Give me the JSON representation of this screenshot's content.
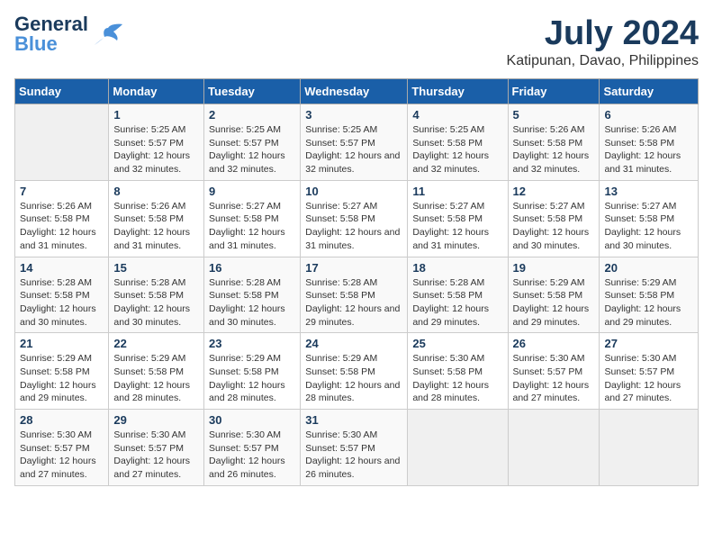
{
  "header": {
    "logo_line1": "General",
    "logo_line2": "Blue",
    "month_year": "July 2024",
    "location": "Katipunan, Davao, Philippines"
  },
  "days_of_week": [
    "Sunday",
    "Monday",
    "Tuesday",
    "Wednesday",
    "Thursday",
    "Friday",
    "Saturday"
  ],
  "weeks": [
    [
      {
        "day": "",
        "empty": true
      },
      {
        "day": "1",
        "sunrise": "Sunrise: 5:25 AM",
        "sunset": "Sunset: 5:57 PM",
        "daylight": "Daylight: 12 hours and 32 minutes."
      },
      {
        "day": "2",
        "sunrise": "Sunrise: 5:25 AM",
        "sunset": "Sunset: 5:57 PM",
        "daylight": "Daylight: 12 hours and 32 minutes."
      },
      {
        "day": "3",
        "sunrise": "Sunrise: 5:25 AM",
        "sunset": "Sunset: 5:57 PM",
        "daylight": "Daylight: 12 hours and 32 minutes."
      },
      {
        "day": "4",
        "sunrise": "Sunrise: 5:25 AM",
        "sunset": "Sunset: 5:58 PM",
        "daylight": "Daylight: 12 hours and 32 minutes."
      },
      {
        "day": "5",
        "sunrise": "Sunrise: 5:26 AM",
        "sunset": "Sunset: 5:58 PM",
        "daylight": "Daylight: 12 hours and 32 minutes."
      },
      {
        "day": "6",
        "sunrise": "Sunrise: 5:26 AM",
        "sunset": "Sunset: 5:58 PM",
        "daylight": "Daylight: 12 hours and 31 minutes."
      }
    ],
    [
      {
        "day": "7",
        "sunrise": "Sunrise: 5:26 AM",
        "sunset": "Sunset: 5:58 PM",
        "daylight": "Daylight: 12 hours and 31 minutes."
      },
      {
        "day": "8",
        "sunrise": "Sunrise: 5:26 AM",
        "sunset": "Sunset: 5:58 PM",
        "daylight": "Daylight: 12 hours and 31 minutes."
      },
      {
        "day": "9",
        "sunrise": "Sunrise: 5:27 AM",
        "sunset": "Sunset: 5:58 PM",
        "daylight": "Daylight: 12 hours and 31 minutes."
      },
      {
        "day": "10",
        "sunrise": "Sunrise: 5:27 AM",
        "sunset": "Sunset: 5:58 PM",
        "daylight": "Daylight: 12 hours and 31 minutes."
      },
      {
        "day": "11",
        "sunrise": "Sunrise: 5:27 AM",
        "sunset": "Sunset: 5:58 PM",
        "daylight": "Daylight: 12 hours and 31 minutes."
      },
      {
        "day": "12",
        "sunrise": "Sunrise: 5:27 AM",
        "sunset": "Sunset: 5:58 PM",
        "daylight": "Daylight: 12 hours and 30 minutes."
      },
      {
        "day": "13",
        "sunrise": "Sunrise: 5:27 AM",
        "sunset": "Sunset: 5:58 PM",
        "daylight": "Daylight: 12 hours and 30 minutes."
      }
    ],
    [
      {
        "day": "14",
        "sunrise": "Sunrise: 5:28 AM",
        "sunset": "Sunset: 5:58 PM",
        "daylight": "Daylight: 12 hours and 30 minutes."
      },
      {
        "day": "15",
        "sunrise": "Sunrise: 5:28 AM",
        "sunset": "Sunset: 5:58 PM",
        "daylight": "Daylight: 12 hours and 30 minutes."
      },
      {
        "day": "16",
        "sunrise": "Sunrise: 5:28 AM",
        "sunset": "Sunset: 5:58 PM",
        "daylight": "Daylight: 12 hours and 30 minutes."
      },
      {
        "day": "17",
        "sunrise": "Sunrise: 5:28 AM",
        "sunset": "Sunset: 5:58 PM",
        "daylight": "Daylight: 12 hours and 29 minutes."
      },
      {
        "day": "18",
        "sunrise": "Sunrise: 5:28 AM",
        "sunset": "Sunset: 5:58 PM",
        "daylight": "Daylight: 12 hours and 29 minutes."
      },
      {
        "day": "19",
        "sunrise": "Sunrise: 5:29 AM",
        "sunset": "Sunset: 5:58 PM",
        "daylight": "Daylight: 12 hours and 29 minutes."
      },
      {
        "day": "20",
        "sunrise": "Sunrise: 5:29 AM",
        "sunset": "Sunset: 5:58 PM",
        "daylight": "Daylight: 12 hours and 29 minutes."
      }
    ],
    [
      {
        "day": "21",
        "sunrise": "Sunrise: 5:29 AM",
        "sunset": "Sunset: 5:58 PM",
        "daylight": "Daylight: 12 hours and 29 minutes."
      },
      {
        "day": "22",
        "sunrise": "Sunrise: 5:29 AM",
        "sunset": "Sunset: 5:58 PM",
        "daylight": "Daylight: 12 hours and 28 minutes."
      },
      {
        "day": "23",
        "sunrise": "Sunrise: 5:29 AM",
        "sunset": "Sunset: 5:58 PM",
        "daylight": "Daylight: 12 hours and 28 minutes."
      },
      {
        "day": "24",
        "sunrise": "Sunrise: 5:29 AM",
        "sunset": "Sunset: 5:58 PM",
        "daylight": "Daylight: 12 hours and 28 minutes."
      },
      {
        "day": "25",
        "sunrise": "Sunrise: 5:30 AM",
        "sunset": "Sunset: 5:58 PM",
        "daylight": "Daylight: 12 hours and 28 minutes."
      },
      {
        "day": "26",
        "sunrise": "Sunrise: 5:30 AM",
        "sunset": "Sunset: 5:57 PM",
        "daylight": "Daylight: 12 hours and 27 minutes."
      },
      {
        "day": "27",
        "sunrise": "Sunrise: 5:30 AM",
        "sunset": "Sunset: 5:57 PM",
        "daylight": "Daylight: 12 hours and 27 minutes."
      }
    ],
    [
      {
        "day": "28",
        "sunrise": "Sunrise: 5:30 AM",
        "sunset": "Sunset: 5:57 PM",
        "daylight": "Daylight: 12 hours and 27 minutes."
      },
      {
        "day": "29",
        "sunrise": "Sunrise: 5:30 AM",
        "sunset": "Sunset: 5:57 PM",
        "daylight": "Daylight: 12 hours and 27 minutes."
      },
      {
        "day": "30",
        "sunrise": "Sunrise: 5:30 AM",
        "sunset": "Sunset: 5:57 PM",
        "daylight": "Daylight: 12 hours and 26 minutes."
      },
      {
        "day": "31",
        "sunrise": "Sunrise: 5:30 AM",
        "sunset": "Sunset: 5:57 PM",
        "daylight": "Daylight: 12 hours and 26 minutes."
      },
      {
        "day": "",
        "empty": true
      },
      {
        "day": "",
        "empty": true
      },
      {
        "day": "",
        "empty": true
      }
    ]
  ]
}
